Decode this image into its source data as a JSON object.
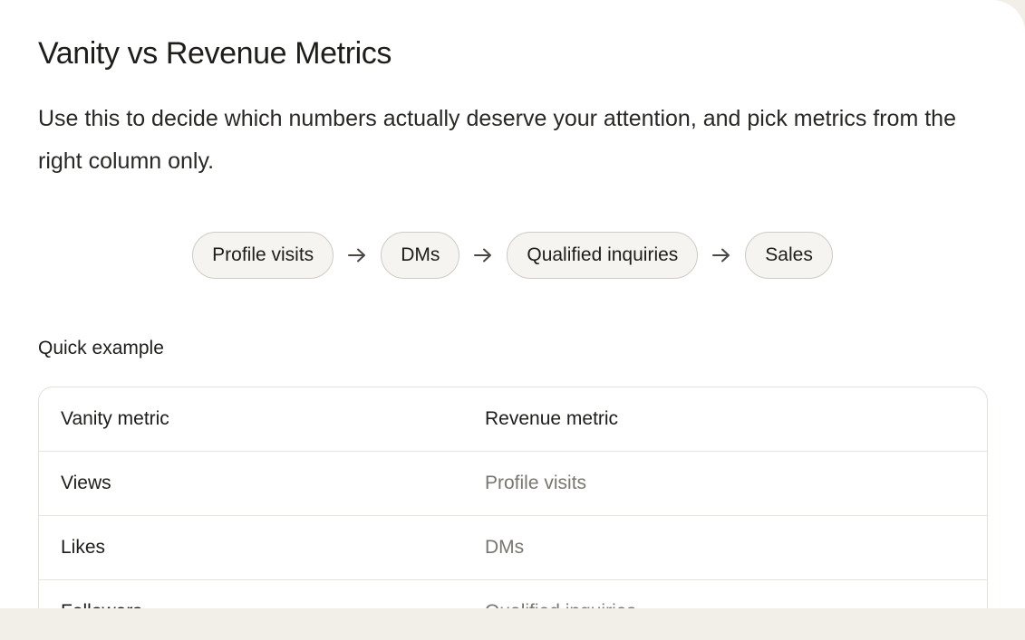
{
  "title": "Vanity vs Revenue Metrics",
  "description": "Use this to decide which numbers actually deserve your attention, and pick metrics from the right column only.",
  "flow": {
    "steps": [
      "Profile visits",
      "DMs",
      "Qualified inquiries",
      "Sales"
    ],
    "arrow_icon": "arrow-right-icon"
  },
  "example": {
    "label": "Quick example",
    "headers": [
      "Vanity metric",
      "Revenue metric"
    ],
    "rows": [
      [
        "Views",
        "Profile visits"
      ],
      [
        "Likes",
        "DMs"
      ],
      [
        "Followers",
        "Qualified inquiries"
      ]
    ]
  },
  "colors": {
    "page_background": "#f2efe9",
    "card_background": "#ffffff",
    "muted_text": "#7a766f",
    "pill_background": "#f6f4f0"
  }
}
